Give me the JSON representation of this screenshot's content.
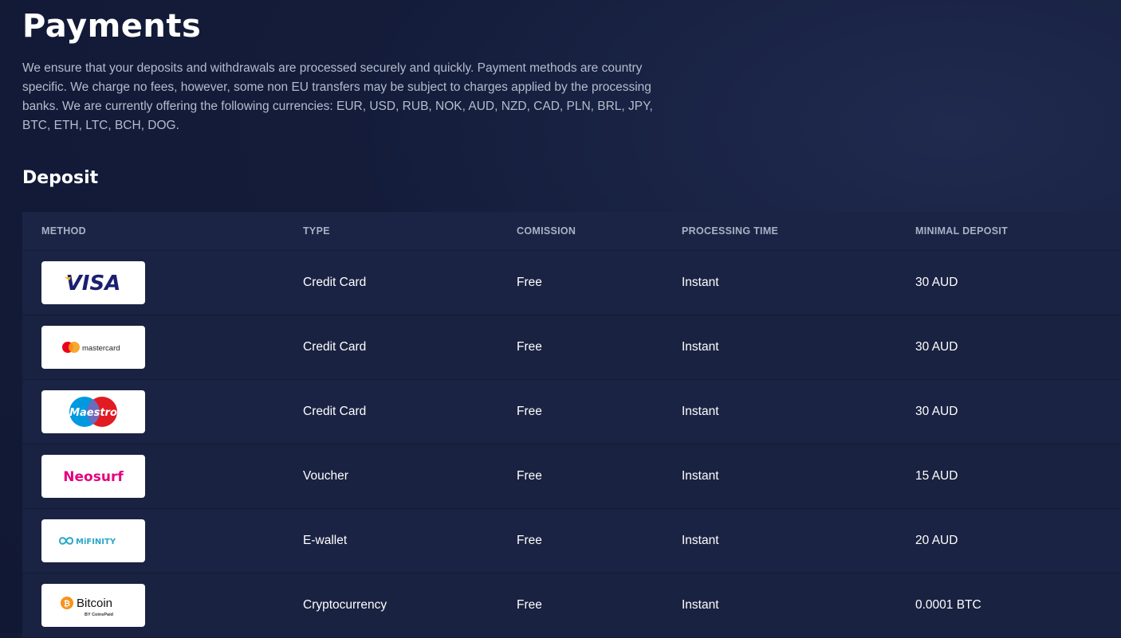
{
  "page": {
    "title": "Payments",
    "intro": "We ensure that your deposits and withdrawals are processed securely and quickly. Payment methods are country specific. We charge no fees, however, some non EU transfers may be subject to charges applied by the processing banks. We are currently offering the following currencies: EUR, USD, RUB, NOK, AUD, NZD, CAD, PLN, BRL, JPY, BTC, ETH, LTC, BCH, DOG.",
    "section_title": "Deposit"
  },
  "table": {
    "headers": [
      "METHOD",
      "TYPE",
      "COMISSION",
      "PROCESSING TIME",
      "MINIMAL DEPOSIT"
    ],
    "rows": [
      {
        "logo": "visa-logo",
        "logo_text": "VISA",
        "type": "Credit Card",
        "commission": "Free",
        "time": "Instant",
        "min": "30 AUD"
      },
      {
        "logo": "mastercard-logo",
        "logo_text": "mastercard",
        "type": "Credit Card",
        "commission": "Free",
        "time": "Instant",
        "min": "30 AUD"
      },
      {
        "logo": "maestro-logo",
        "logo_text": "Maestro",
        "type": "Credit Card",
        "commission": "Free",
        "time": "Instant",
        "min": "30 AUD"
      },
      {
        "logo": "neosurf-logo",
        "logo_text": "Neosurf",
        "type": "Voucher",
        "commission": "Free",
        "time": "Instant",
        "min": "15 AUD"
      },
      {
        "logo": "mifinity-logo",
        "logo_text": "MiFINITY",
        "type": "E-wallet",
        "commission": "Free",
        "time": "Instant",
        "min": "20 AUD"
      },
      {
        "logo": "bitcoin-logo",
        "logo_text": "Bitcoin",
        "logo_subtext": "BY CoinsPaid",
        "type": "Cryptocurrency",
        "commission": "Free",
        "time": "Instant",
        "min": "0.0001 BTC"
      }
    ]
  },
  "colors": {
    "background": "#141c3a",
    "table_row": "#1a2241",
    "header_text": "#aab1c5",
    "visa_blue": "#1a1f71",
    "visa_gold": "#f7b600",
    "mc_red": "#eb001b",
    "mc_yellow": "#f79e1b",
    "maestro_blue": "#0099df",
    "neosurf_pink": "#e5007e",
    "mifinity_teal": "#2aa7c8",
    "bitcoin_orange": "#f7931a"
  }
}
